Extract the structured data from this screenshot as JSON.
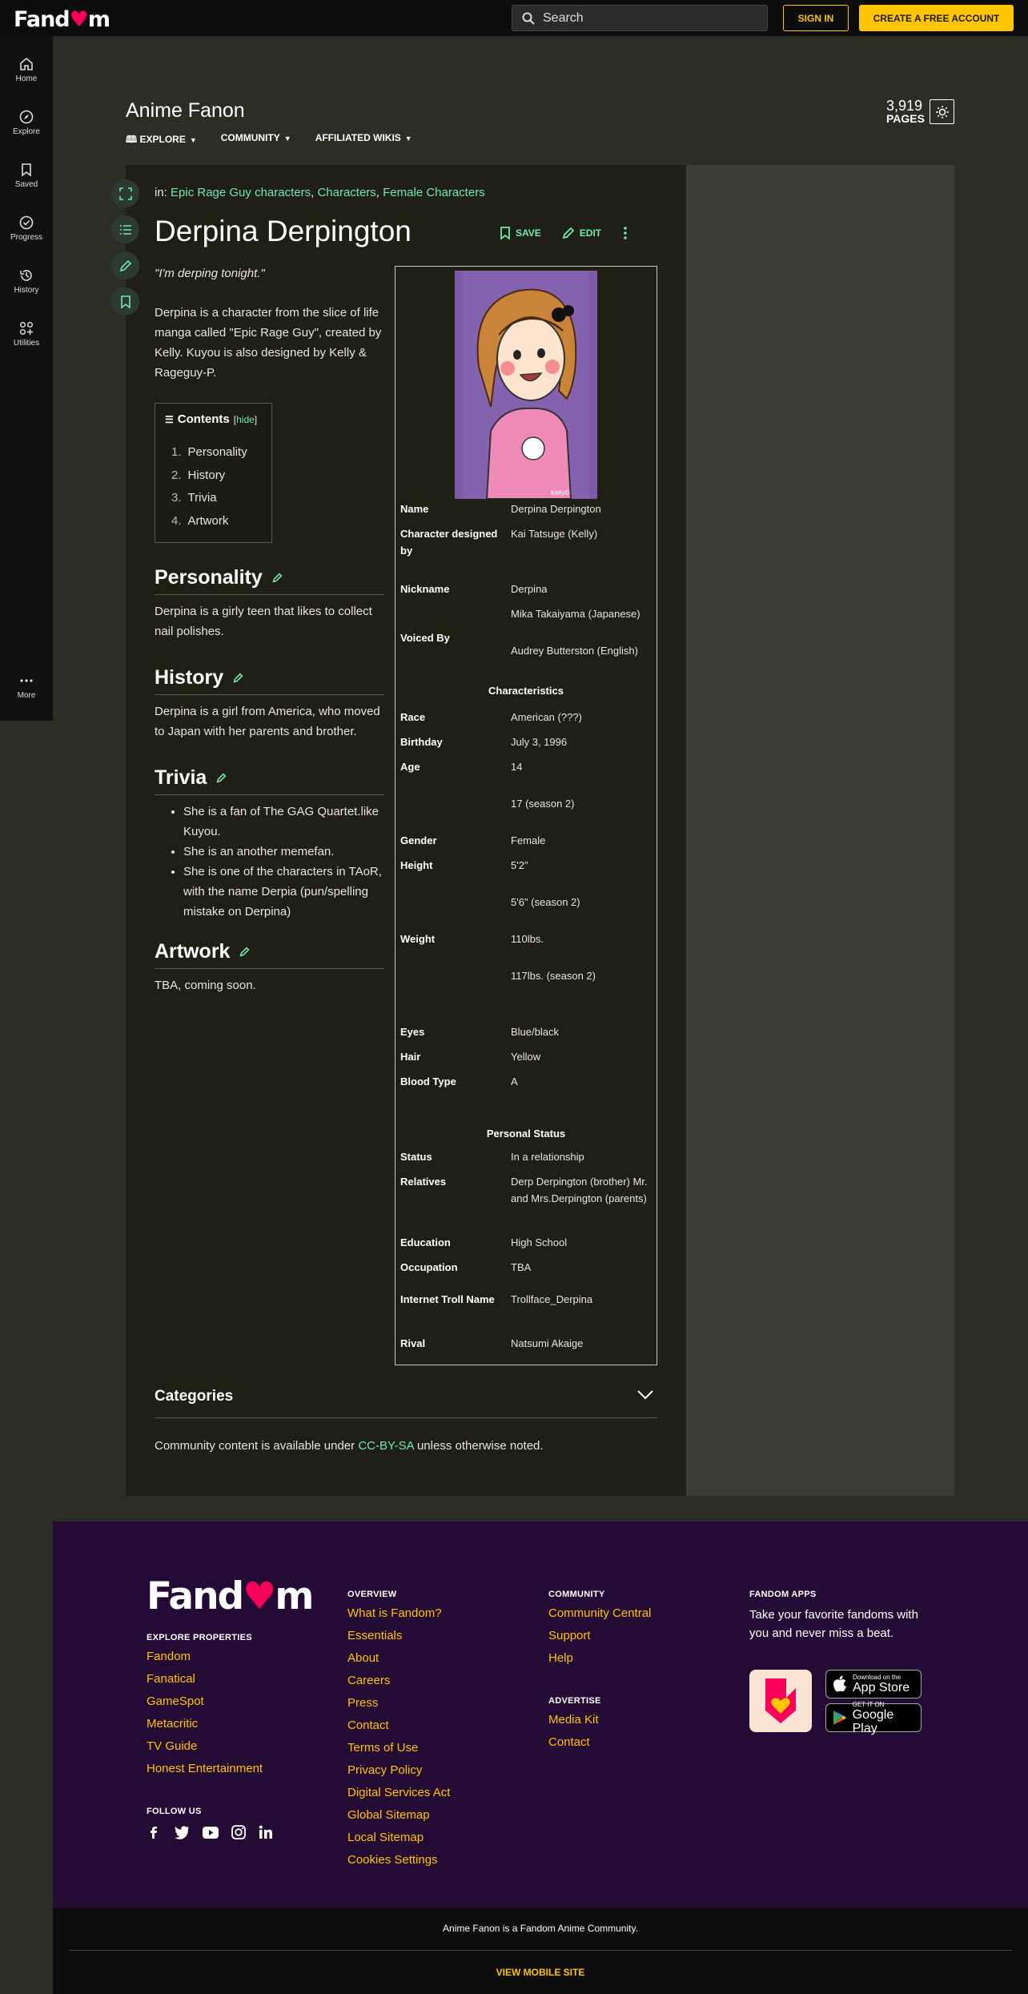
{
  "topbar": {
    "logo_left": "Fand",
    "logo_right": "m",
    "search_placeholder": "Search",
    "sign_in": "SIGN IN",
    "create_account": "CREATE A FREE ACCOUNT"
  },
  "rail": [
    {
      "label": "Home",
      "icon": "home-icon"
    },
    {
      "label": "Explore",
      "icon": "compass-icon"
    },
    {
      "label": "Saved",
      "icon": "bookmark-icon"
    },
    {
      "label": "Progress",
      "icon": "check-circle-icon"
    },
    {
      "label": "History",
      "icon": "history-icon"
    },
    {
      "label": "Utilities",
      "icon": "grid-icon"
    },
    {
      "label": "More",
      "icon": "more-icon"
    }
  ],
  "wiki": {
    "title": "Anime Fanon",
    "nav": [
      "EXPLORE",
      "COMMUNITY",
      "AFFILIATED WIKIS"
    ],
    "pages_count": "3,919",
    "pages_label": "PAGES"
  },
  "article": {
    "in_label": "in:",
    "categories": [
      "Epic Rage Guy characters",
      "Characters",
      "Female Characters"
    ],
    "title": "Derpina Derpington",
    "save": "SAVE",
    "edit": "EDIT",
    "quote": "\"I'm derping tonight.\"",
    "intro": "Derpina is a character from the slice of life manga called \"Epic Rage Guy\", created by Kelly. Kuyou is also designed by Kelly & Rageguy-P.",
    "toc_title": "Contents",
    "toc_hide": "hide",
    "toc": [
      {
        "n": "1.",
        "t": "Personality"
      },
      {
        "n": "2.",
        "t": "History"
      },
      {
        "n": "3.",
        "t": "Trivia"
      },
      {
        "n": "4.",
        "t": "Artwork"
      }
    ],
    "sections": {
      "personality": {
        "title": "Personality",
        "text": "Derpina is a girly teen that likes to collect nail polishes."
      },
      "history": {
        "title": "History",
        "text": "Derpina is a girl from America, who moved to Japan with her parents and brother."
      },
      "trivia": {
        "title": "Trivia",
        "items": [
          "She is a fan of The GAG Quartet.like Kuyou.",
          "She is an another memefan.",
          "She is one of the characters in TAoR, with the name Derpia (pun/spelling mistake on Derpina)"
        ]
      },
      "artwork": {
        "title": "Artwork",
        "text": "TBA, coming soon."
      }
    },
    "categories_heading": "Categories",
    "license_pre": "Community content is available under",
    "license_link": "CC-BY-SA",
    "license_post": "unless otherwise noted."
  },
  "infobox": {
    "image_caption": "Kelly©",
    "rows": [
      {
        "k": "Name",
        "v": "Derpina Derpington"
      },
      {
        "k": "Character designed by",
        "v": "Kai Tatsuge (Kelly)"
      },
      {
        "k": "Nickname",
        "v": "Derpina"
      },
      {
        "k": "",
        "v": "Mika Takaiyama (Japanese)"
      },
      {
        "k": "Voiced By",
        "v": ""
      },
      {
        "k": "",
        "v": "Audrey Butterston (English)"
      },
      {
        "k": "Race",
        "v": "American (???)"
      },
      {
        "k": "Birthday",
        "v": "July 3, 1996"
      },
      {
        "k": "Age",
        "v": "14"
      },
      {
        "k": "",
        "v": "17 (season 2)"
      },
      {
        "k": "Gender",
        "v": "Female"
      },
      {
        "k": "Height",
        "v": "5'2\""
      },
      {
        "k": "",
        "v": "5'6\" (season 2)"
      },
      {
        "k": "Weight",
        "v": "110lbs."
      },
      {
        "k": "",
        "v": "117lbs. (season 2)"
      },
      {
        "k": "Eyes",
        "v": "Blue/black"
      },
      {
        "k": "Hair",
        "v": "Yellow"
      },
      {
        "k": "Blood Type",
        "v": "A"
      },
      {
        "k": "Status",
        "v": "In a relationship"
      },
      {
        "k": "Relatives",
        "v": "Derp Derpington (brother) Mr. and Mrs.Derpington (parents)"
      },
      {
        "k": "Education",
        "v": "High School"
      },
      {
        "k": "Occupation",
        "v": "TBA"
      },
      {
        "k": "Internet Troll Name",
        "v": "Trollface_Derpina"
      },
      {
        "k": "Rival",
        "v": "Natsumi Akaige"
      }
    ],
    "headers": [
      "Characteristics",
      "Personal Status"
    ]
  },
  "footer": {
    "logo_left": "Fand",
    "logo_right": "m",
    "explore_title": "EXPLORE PROPERTIES",
    "explore": [
      "Fandom",
      "Fanatical",
      "GameSpot",
      "Metacritic",
      "TV Guide",
      "Honest Entertainment"
    ],
    "follow_title": "FOLLOW US",
    "overview_title": "OVERVIEW",
    "overview": [
      "What is Fandom?",
      "Essentials",
      "About",
      "Careers",
      "Press",
      "Contact",
      "Terms of Use",
      "Privacy Policy",
      "Digital Services Act",
      "Global Sitemap",
      "Local Sitemap",
      "Cookies Settings"
    ],
    "community_title": "COMMUNITY",
    "community": [
      "Community Central",
      "Support",
      "Help"
    ],
    "advertise_title": "ADVERTISE",
    "advertise": [
      "Media Kit",
      "Contact"
    ],
    "apps_title": "FANDOM APPS",
    "apps_text": "Take your favorite fandoms with you and never miss a beat.",
    "appstore_small": "Download on the",
    "appstore_big": "App Store",
    "gplay_small": "GET IT ON",
    "gplay_big": "Google Play",
    "community_note": "Anime Fanon is a Fandom Anime Community.",
    "mobile_site": "VIEW MOBILE SITE"
  },
  "colors": {
    "accent": "#6ee9b3",
    "brand_yellow": "#ffc500",
    "brand_pink": "#fa005a",
    "footer_bg": "#240b35"
  }
}
